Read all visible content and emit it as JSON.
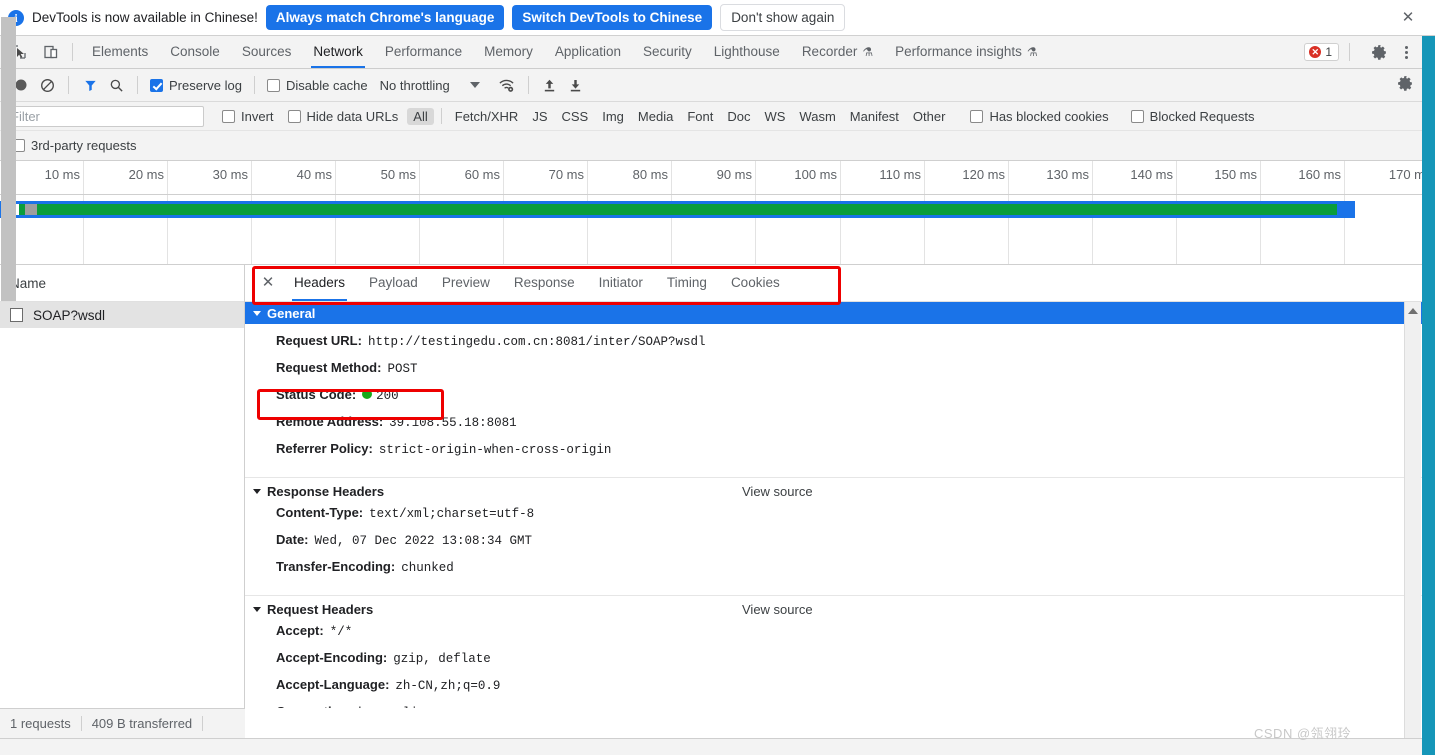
{
  "notification": {
    "icon": "info-icon",
    "message": "DevTools is now available in Chinese!",
    "primary_button": "Always match Chrome's language",
    "secondary_button": "Switch DevTools to Chinese",
    "dismiss_button": "Don't show again",
    "close_icon": "✕"
  },
  "toolbar": {
    "inspect_icon": "inspect-element-icon",
    "device_icon": "device-toolbar-icon",
    "tabs": [
      {
        "label": "Elements",
        "active": false,
        "flask": false
      },
      {
        "label": "Console",
        "active": false,
        "flask": false
      },
      {
        "label": "Sources",
        "active": false,
        "flask": false
      },
      {
        "label": "Network",
        "active": true,
        "flask": false
      },
      {
        "label": "Performance",
        "active": false,
        "flask": false
      },
      {
        "label": "Memory",
        "active": false,
        "flask": false
      },
      {
        "label": "Application",
        "active": false,
        "flask": false
      },
      {
        "label": "Security",
        "active": false,
        "flask": false
      },
      {
        "label": "Lighthouse",
        "active": false,
        "flask": false
      },
      {
        "label": "Recorder",
        "active": false,
        "flask": true
      },
      {
        "label": "Performance insights",
        "active": false,
        "flask": true
      }
    ],
    "error_count": "1",
    "settings_icon": "gear-icon",
    "more_icon": "kebab-menu-icon"
  },
  "network_toolbar": {
    "record_icon": "record-button-icon",
    "clear_icon": "clear-network-log-icon",
    "filter_icon": "filter-funnel-icon",
    "search_icon": "search-icon",
    "preserve_log": {
      "label": "Preserve log",
      "checked": true
    },
    "disable_cache": {
      "label": "Disable cache",
      "checked": false
    },
    "throttling": "No throttling",
    "throttle_caret": "chevron-down-icon",
    "wifi_icon": "network-conditions-icon",
    "import_icon": "import-har-icon",
    "export_icon": "export-har-icon",
    "settings_icon": "network-settings-gear-icon"
  },
  "filter_row": {
    "placeholder": "Filter",
    "value": "",
    "invert": {
      "label": "Invert",
      "checked": false
    },
    "hide_data_urls": {
      "label": "Hide data URLs",
      "checked": false
    },
    "types": [
      "All",
      "Fetch/XHR",
      "JS",
      "CSS",
      "Img",
      "Media",
      "Font",
      "Doc",
      "WS",
      "Wasm",
      "Manifest",
      "Other"
    ],
    "selected_type": "All",
    "has_blocked_cookies": {
      "label": "Has blocked cookies",
      "checked": false
    },
    "blocked_requests": {
      "label": "Blocked Requests",
      "checked": false
    },
    "third_party": {
      "label": "3rd-party requests",
      "checked": false
    }
  },
  "timeline": {
    "ticks": [
      "10 ms",
      "20 ms",
      "30 ms",
      "40 ms",
      "50 ms",
      "60 ms",
      "70 ms",
      "80 ms",
      "90 ms",
      "100 ms",
      "110 ms",
      "120 ms",
      "130 ms",
      "140 ms",
      "150 ms",
      "160 ms",
      "170 m"
    ],
    "bar_color_outer": "#1a73e8",
    "bar_color_inner": "#0a9d3c"
  },
  "requests_panel": {
    "column_header": "Name",
    "rows": [
      {
        "icon": "document-icon",
        "name": "SOAP?wsdl",
        "selected": true
      }
    ]
  },
  "detail_panel": {
    "close_icon": "✕",
    "tabs": [
      {
        "label": "Headers",
        "active": true
      },
      {
        "label": "Payload",
        "active": false
      },
      {
        "label": "Preview",
        "active": false
      },
      {
        "label": "Response",
        "active": false
      },
      {
        "label": "Initiator",
        "active": false
      },
      {
        "label": "Timing",
        "active": false
      },
      {
        "label": "Cookies",
        "active": false
      }
    ],
    "sections": [
      {
        "title": "General",
        "highlight": true,
        "view_source": null,
        "rows": [
          {
            "key": "Request URL:",
            "value": "http://testingedu.com.cn:8081/inter/SOAP?wsdl"
          },
          {
            "key": "Request Method:",
            "value": "POST"
          },
          {
            "key": "Status Code:",
            "value": "200",
            "status_dot": "#17a81a"
          },
          {
            "key": "Remote Address:",
            "value": "39.108.55.18:8081"
          },
          {
            "key": "Referrer Policy:",
            "value": "strict-origin-when-cross-origin"
          }
        ]
      },
      {
        "title": "Response Headers",
        "highlight": false,
        "view_source": "View source",
        "rows": [
          {
            "key": "Content-Type:",
            "value": "text/xml;charset=utf-8"
          },
          {
            "key": "Date:",
            "value": "Wed, 07 Dec 2022 13:08:34 GMT"
          },
          {
            "key": "Transfer-Encoding:",
            "value": "chunked"
          }
        ]
      },
      {
        "title": "Request Headers",
        "highlight": false,
        "view_source": "View source",
        "rows": [
          {
            "key": "Accept:",
            "value": "*/*"
          },
          {
            "key": "Accept-Encoding:",
            "value": "gzip, deflate"
          },
          {
            "key": "Accept-Language:",
            "value": "zh-CN,zh;q=0.9"
          },
          {
            "key": "Connection:",
            "value": "keep-alive"
          }
        ]
      }
    ]
  },
  "status_bar": {
    "requests": "1 requests",
    "transferred": "409 B transferred"
  },
  "watermark": "CSDN @瓴翎玲",
  "annotations": {
    "box_tabs": "red-highlight-around-detail-tabs",
    "box_status": "red-highlight-around-status-code",
    "color": "#ee0000"
  }
}
